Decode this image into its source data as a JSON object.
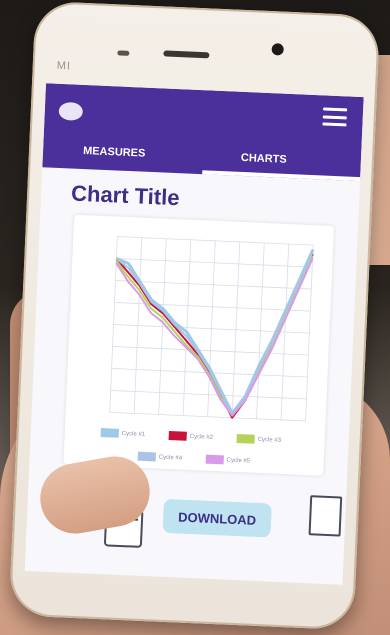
{
  "device": {
    "brand": "MI"
  },
  "app": {
    "tabs": [
      {
        "label": "MEASURES",
        "active": false
      },
      {
        "label": "CHARTS",
        "active": true
      }
    ],
    "download_label": "DOWNLOAD",
    "accent_color": "#4b2f9b",
    "secondary_color": "#bfe3f0"
  },
  "chart_data": {
    "type": "line",
    "title": "Chart Title",
    "xlabel": "",
    "ylabel": "",
    "grid": true,
    "legend_placement": "bottom",
    "x": [
      0,
      1,
      2,
      3,
      4,
      5,
      6,
      7,
      8,
      9,
      10,
      11,
      12,
      13,
      14,
      15,
      16
    ],
    "series": [
      {
        "name": "Cycle #1",
        "color": "#9ec9e8",
        "values": [
          70,
          68,
          60,
          52,
          48,
          42,
          38,
          30,
          22,
          12,
          2,
          10,
          24,
          36,
          50,
          64,
          78
        ]
      },
      {
        "name": "Cycle #2",
        "color": "#c8123a",
        "values": [
          70,
          64,
          58,
          50,
          46,
          40,
          34,
          28,
          20,
          10,
          0,
          8,
          22,
          34,
          48,
          62,
          76
        ]
      },
      {
        "name": "Cycle #3",
        "color": "#b5d35a",
        "values": [
          69,
          62,
          56,
          48,
          44,
          38,
          32,
          27,
          19,
          9,
          1,
          9,
          21,
          33,
          47,
          61,
          75
        ]
      },
      {
        "name": "Cycle #4",
        "color": "#aac4e7",
        "values": [
          70,
          66,
          59,
          51,
          47,
          41,
          36,
          29,
          21,
          11,
          1,
          9,
          23,
          35,
          49,
          63,
          77
        ]
      },
      {
        "name": "Cycle #5",
        "color": "#d89bea",
        "values": [
          68,
          60,
          54,
          46,
          42,
          36,
          31,
          26,
          18,
          8,
          1,
          8,
          20,
          32,
          46,
          60,
          74
        ]
      }
    ],
    "ylim": [
      0,
      80
    ]
  }
}
